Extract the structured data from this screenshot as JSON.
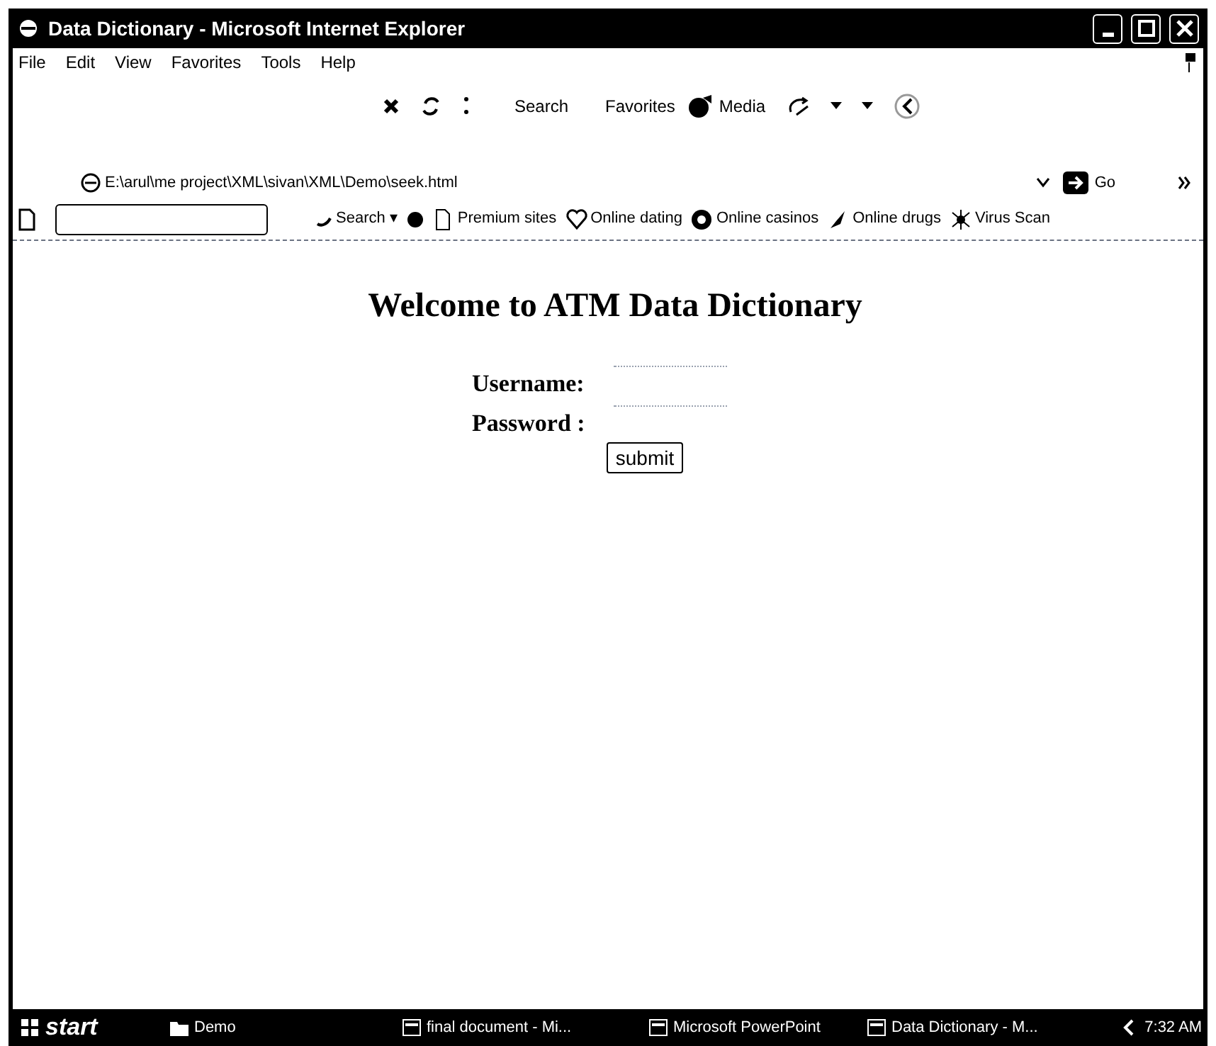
{
  "window": {
    "title": "Data Dictionary - Microsoft Internet Explorer"
  },
  "menu": [
    "File",
    "Edit",
    "View",
    "Favorites",
    "Tools",
    "Help"
  ],
  "toolbar": {
    "search": "Search",
    "favorites": "Favorites",
    "media": "Media"
  },
  "address": {
    "value": "E:\\arul\\me project\\XML\\sivan\\XML\\Demo\\seek.html",
    "go": "Go"
  },
  "links_bar": {
    "search": "Search ▾",
    "links": [
      "Premium sites",
      "Online dating",
      "Online casinos",
      "Online drugs",
      "Virus Scan"
    ]
  },
  "page": {
    "heading": "Welcome to ATM Data Dictionary",
    "fields": [
      {
        "label": "Username:"
      },
      {
        "label": "Password :"
      }
    ],
    "submit": "submit"
  },
  "taskbar": {
    "start": "start",
    "items": [
      "Demo",
      "final document - Mi...",
      "Microsoft PowerPoint",
      "Data Dictionary - M..."
    ],
    "clock": "7:32 AM"
  }
}
